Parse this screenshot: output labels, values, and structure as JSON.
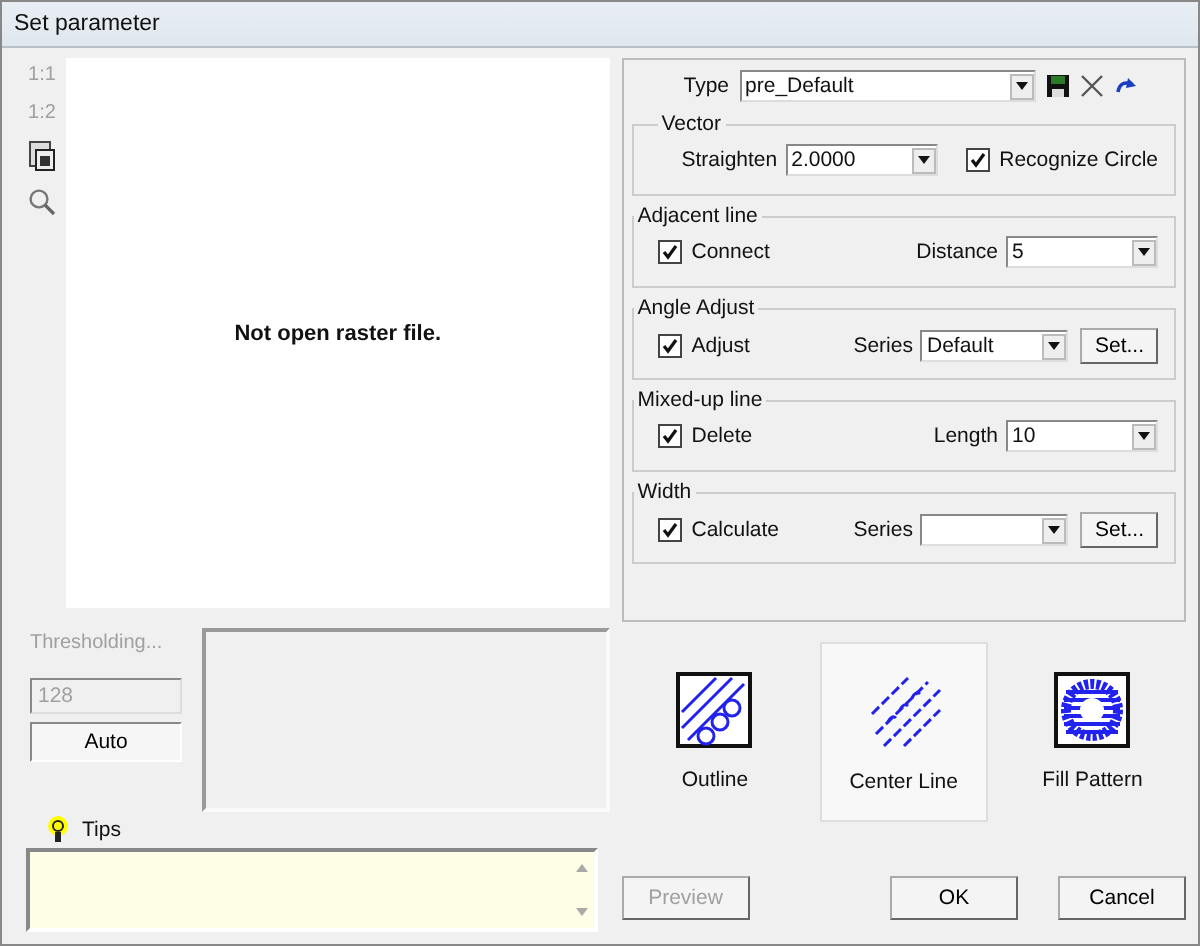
{
  "window": {
    "title": "Set parameter"
  },
  "toolbar": [
    {
      "kind": "text",
      "label": "1:1",
      "disabled": true
    },
    {
      "kind": "text",
      "label": "1:2",
      "disabled": true
    },
    {
      "kind": "fit",
      "disabled": false
    },
    {
      "kind": "zoom",
      "disabled": false
    }
  ],
  "canvas": {
    "message": "Not open raster file."
  },
  "type": {
    "label": "Type",
    "value": "pre_Default"
  },
  "groups": [
    {
      "title": "Vector",
      "kind": "vector",
      "items": [
        {
          "kind": "combo",
          "label": "Straighten",
          "value": "2.0000"
        },
        {
          "kind": "checkbox",
          "label": "Recognize Circle",
          "checked": true
        }
      ]
    },
    {
      "title": "Adjacent line",
      "kind": "option",
      "items": [
        {
          "kind": "checkbox",
          "label": "Connect",
          "checked": true
        },
        {
          "kind": "combo",
          "label": "Distance",
          "value": "5"
        }
      ]
    },
    {
      "title": "Angle Adjust",
      "kind": "option",
      "items": [
        {
          "kind": "checkbox",
          "label": "Adjust",
          "checked": true
        },
        {
          "kind": "combo",
          "label": "Series",
          "value": "Default"
        },
        {
          "kind": "button",
          "label": "Set..."
        }
      ]
    },
    {
      "title": "Mixed-up line",
      "kind": "option",
      "items": [
        {
          "kind": "checkbox",
          "label": "Delete",
          "checked": true
        },
        {
          "kind": "combo",
          "label": "Length",
          "value": "10"
        }
      ]
    },
    {
      "title": "Width",
      "kind": "option",
      "items": [
        {
          "kind": "checkbox",
          "label": "Calculate",
          "checked": true
        },
        {
          "kind": "combo",
          "label": "Series",
          "value": ""
        },
        {
          "kind": "button",
          "label": "Set..."
        }
      ]
    }
  ],
  "threshold": {
    "label": "Thresholding...",
    "disabled": true,
    "value": "128",
    "button": "Auto"
  },
  "tips": {
    "label": "Tips"
  },
  "modes": [
    {
      "kind": "outline",
      "label": "Outline",
      "selected": false
    },
    {
      "kind": "centerline",
      "label": "Center Line",
      "selected": true
    },
    {
      "kind": "fill",
      "label": "Fill Pattern",
      "selected": false
    }
  ],
  "buttons": [
    {
      "label": "Preview",
      "disabled": true
    },
    {
      "label": "OK",
      "disabled": false
    },
    {
      "label": "Cancel",
      "disabled": false
    }
  ]
}
